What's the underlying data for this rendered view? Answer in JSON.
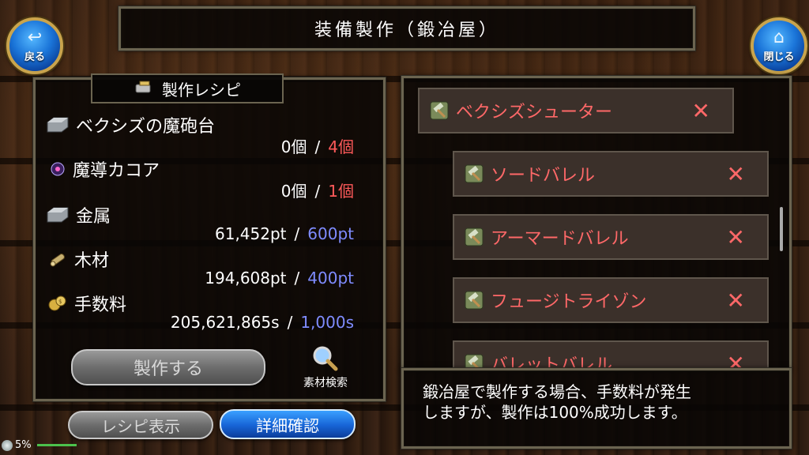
{
  "header": {
    "title": "装備製作（鍛冶屋）"
  },
  "nav": {
    "back_label": "戻る",
    "back_icon": "back-arrow-icon",
    "close_label": "閉じる",
    "close_icon": "home-icon"
  },
  "recipe_panel": {
    "title": "製作レシピ",
    "materials": [
      {
        "name": "ベクシズの魔砲台",
        "have": "0個",
        "need": "4個",
        "icon": "metal-ingot-icon",
        "need_color": "#ff5a5a"
      },
      {
        "name": "魔導カコア",
        "have": "0個",
        "need": "1個",
        "icon": "magic-orb-icon",
        "need_color": "#ff5a5a"
      },
      {
        "name": "金属",
        "have": "61,452pt",
        "need": "600pt",
        "icon": "metal-ingot-icon",
        "need_color": "#7f8cff"
      },
      {
        "name": "木材",
        "have": "194,608pt",
        "need": "400pt",
        "icon": "wood-log-icon",
        "need_color": "#7f8cff"
      },
      {
        "name": "手数料",
        "have": "205,621,865s",
        "need": "1,000s",
        "icon": "coin-bag-icon",
        "need_color": "#7f8cff"
      }
    ],
    "separator": "/",
    "craft_button": "製作する",
    "search_label": "素材検索"
  },
  "bottom_buttons": {
    "recipe_view": "レシピ表示",
    "detail_check": "詳細確認"
  },
  "recipe_tree": [
    {
      "name": "ベクシズシューター",
      "status": "✕",
      "icon": "hammer-icon"
    },
    {
      "name": "ソードバレル",
      "status": "✕",
      "icon": "hammer-icon"
    },
    {
      "name": "アーマードバレル",
      "status": "✕",
      "icon": "hammer-icon"
    },
    {
      "name": "フュージトライゾン",
      "status": "✕",
      "icon": "hammer-icon"
    },
    {
      "name": "バレットバレル",
      "status": "✕",
      "icon": "hammer-icon"
    }
  ],
  "info": {
    "line1": "鍛冶屋で製作する場合、手数料が発生",
    "line2": "しますが、製作は100%成功します。"
  },
  "status_bar": {
    "battery": "5%"
  }
}
